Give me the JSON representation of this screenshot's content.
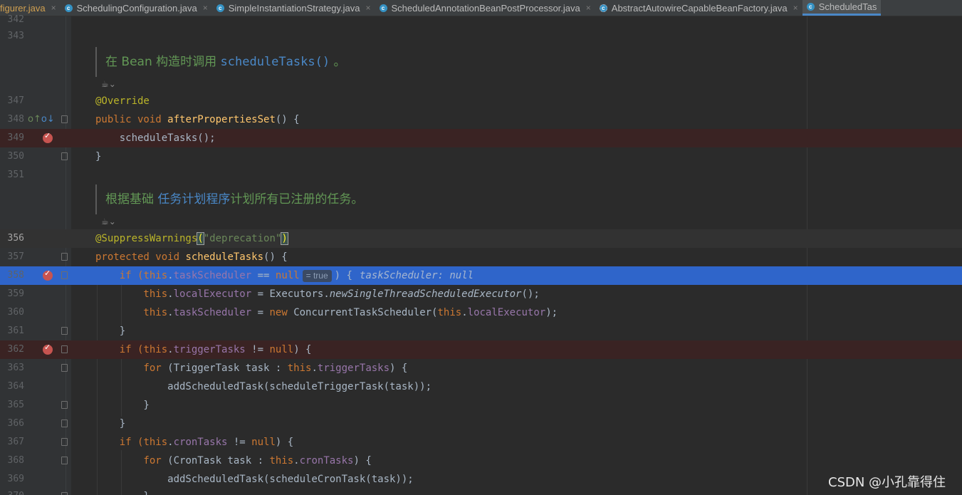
{
  "tabs": [
    {
      "label": "figurer.java",
      "icon": "",
      "active": false
    },
    {
      "label": "SchedulingConfiguration.java",
      "icon": "class-icon",
      "active": false
    },
    {
      "label": "SimpleInstantiationStrategy.java",
      "icon": "class-icon",
      "active": false
    },
    {
      "label": "ScheduledAnnotationBeanPostProcessor.java",
      "icon": "class-icon",
      "active": false
    },
    {
      "label": "AbstractAutowireCapableBeanFactory.java",
      "icon": "abstract-class-icon",
      "active": false
    },
    {
      "label": "ScheduledTas",
      "icon": "class-icon",
      "active": true
    }
  ],
  "tab_close_glyph": "×",
  "line_numbers": {
    "l342": "342",
    "l343": "343",
    "l347": "347",
    "l348": "348",
    "l349": "349",
    "l350": "350",
    "l351": "351",
    "l356": "356",
    "l357": "357",
    "l358": "358",
    "l359": "359",
    "l360": "360",
    "l361": "361",
    "l362": "362",
    "l363": "363",
    "l364": "364",
    "l365": "365",
    "l366": "366",
    "l367": "367",
    "l368": "368",
    "l369": "369",
    "l370": "370"
  },
  "doc1": {
    "prefix": "在 Bean 构造时调用 ",
    "code": "scheduleTasks()",
    "suffix": " 。"
  },
  "doc2": {
    "prefix": "根据基础 ",
    "link": "任务计划程序",
    "suffix": "计划所有已注册的任务。"
  },
  "reader_mode": "☕⌄",
  "code": {
    "c347": "@Override",
    "c348_kw": "public void ",
    "c348_fn": "afterPropertiesSet",
    "c348_rest": "() {",
    "c349": "    scheduleTasks();",
    "c350": "}",
    "c356_ann": "@SuppressWarnings",
    "c356_open": "(",
    "c356_str": "\"deprecation\"",
    "c356_close": ")",
    "c357_kw": "protected void ",
    "c357_fn": "scheduleTasks",
    "c357_rest": "() {",
    "c358_a": "    if (",
    "c358_this": "this",
    "c358_dot": ".",
    "c358_fld": "taskScheduler",
    "c358_b": " == ",
    "c358_null": "null",
    "c358_inlay": "= true",
    "c358_c": ") {",
    "c358_hint": "taskScheduler: null",
    "c359_this": "        this",
    "c359_dot": ".",
    "c359_fld": "localExecutor",
    "c359_b": " = Executors.",
    "c359_it": "newSingleThreadScheduledExecutor",
    "c359_c": "();",
    "c360_this": "        this",
    "c360_dot": ".",
    "c360_fld": "taskScheduler",
    "c360_b": " = ",
    "c360_new": "new ",
    "c360_cls": "ConcurrentTaskScheduler(",
    "c360_this2": "this",
    "c360_dot2": ".",
    "c360_fld2": "localExecutor",
    "c360_c": ");",
    "c361": "    }",
    "c362_a": "    if (",
    "c362_this": "this",
    "c362_dot": ".",
    "c362_fld": "triggerTasks",
    "c362_b": " != ",
    "c362_null": "null",
    "c362_c": ") {",
    "c363_kw": "        for ",
    "c363_a": "(TriggerTask task : ",
    "c363_this": "this",
    "c363_dot": ".",
    "c363_fld": "triggerTasks",
    "c363_c": ") {",
    "c364": "            addScheduledTask(scheduleTriggerTask(task));",
    "c365": "        }",
    "c366": "    }",
    "c367_a": "    if (",
    "c367_this": "this",
    "c367_dot": ".",
    "c367_fld": "cronTasks",
    "c367_b": " != ",
    "c367_null": "null",
    "c367_c": ") {",
    "c368_kw": "        for ",
    "c368_a": "(CronTask task : ",
    "c368_this": "this",
    "c368_dot": ".",
    "c368_fld": "cronTasks",
    "c368_c": ") {",
    "c369": "            addScheduledTask(scheduleCronTask(task));",
    "c370": "        }"
  },
  "watermark": "CSDN @小孔靠得住",
  "colors": {
    "keyword": "#cc7832",
    "method": "#ffc66d",
    "field": "#9876aa",
    "annotation": "#bbb529",
    "string": "#6a8759",
    "execution_line": "#2f65ca",
    "breakpoint_line": "#3a2323"
  }
}
